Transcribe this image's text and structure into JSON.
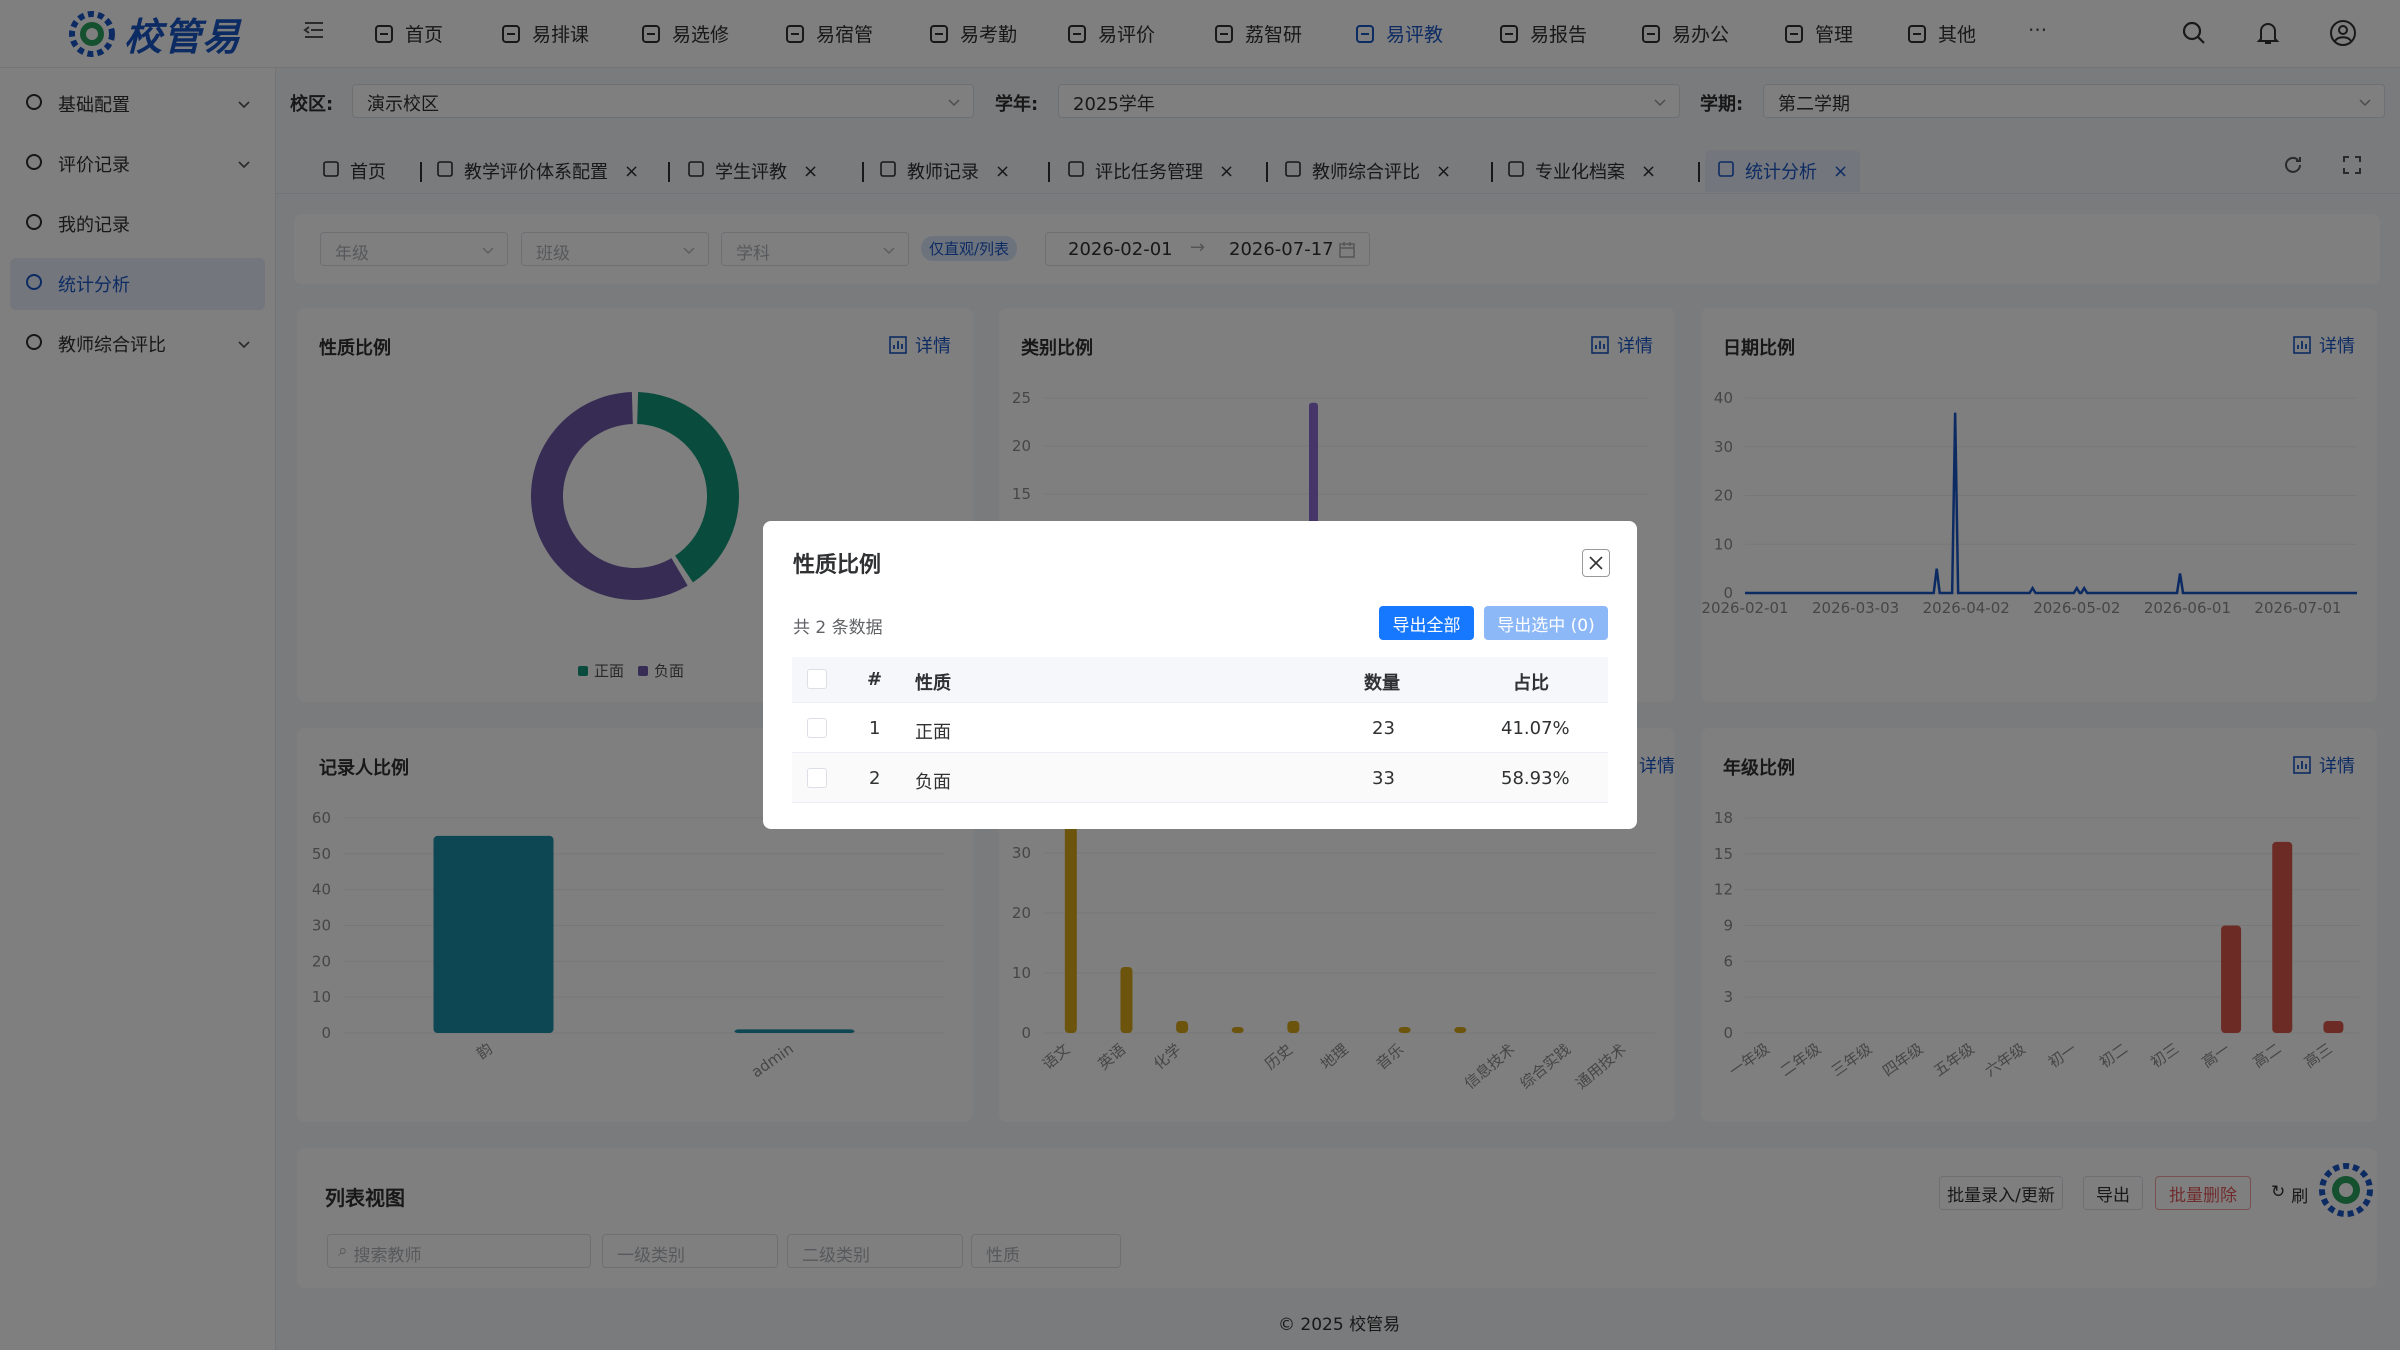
{
  "app": {
    "logo_text": "校管易"
  },
  "topnav": [
    {
      "label": "首页",
      "icon": "monitor-icon"
    },
    {
      "label": "易排课",
      "icon": "calendar-icon"
    },
    {
      "label": "易选修",
      "icon": "book-icon"
    },
    {
      "label": "易宿管",
      "icon": "bed-icon"
    },
    {
      "label": "易考勤",
      "icon": "calendar-check-icon"
    },
    {
      "label": "易评价",
      "icon": "star-icon"
    },
    {
      "label": "荔智研",
      "icon": "research-icon"
    },
    {
      "label": "易评教",
      "icon": "graduation-cap-icon"
    },
    {
      "label": "易报告",
      "icon": "report-icon"
    },
    {
      "label": "易办公",
      "icon": "briefcase-icon"
    },
    {
      "label": "管理",
      "icon": "settings-square-icon"
    },
    {
      "label": "其他",
      "icon": "grid-icon"
    }
  ],
  "topnav_more": "···",
  "sidebar": [
    {
      "label": "基础配置",
      "icon": "gear-icon",
      "expandable": true
    },
    {
      "label": "评价记录",
      "icon": "clipboard-icon",
      "expandable": true
    },
    {
      "label": "我的记录",
      "icon": "record-icon",
      "expandable": false
    },
    {
      "label": "统计分析",
      "icon": "chart-line-icon",
      "expandable": false,
      "active": true
    },
    {
      "label": "教师综合评比",
      "icon": "trophy-icon",
      "expandable": true
    }
  ],
  "filters": {
    "campus_label": "校区:",
    "campus_value": "演示校区",
    "year_label": "学年:",
    "year_value": "2025学年",
    "term_label": "学期:",
    "term_value": "第二学期"
  },
  "tabs": [
    {
      "label": "首页",
      "closable": false
    },
    {
      "label": "教学评价体系配置",
      "closable": true
    },
    {
      "label": "学生评教",
      "closable": true
    },
    {
      "label": "教师记录",
      "closable": true
    },
    {
      "label": "评比任务管理",
      "closable": true
    },
    {
      "label": "教师综合评比",
      "closable": true
    },
    {
      "label": "专业化档案",
      "closable": true
    },
    {
      "label": "统计分析",
      "closable": true,
      "active": true
    }
  ],
  "stats_filters": {
    "grade_placeholder": "年级",
    "class_placeholder": "班级",
    "subject_placeholder": "学科",
    "toggle_label": "仅直观/列表",
    "date_start": "2026-02-01",
    "date_end": "2026-07-17"
  },
  "detail_label": "详情",
  "charts": {
    "nature": {
      "title": "性质比例",
      "legend": [
        "正面",
        "负面"
      ]
    },
    "category": {
      "title": "类别比例"
    },
    "date": {
      "title": "日期比例"
    },
    "recorder": {
      "title": "记录人比例"
    },
    "grade": {
      "title": "年级比例"
    }
  },
  "chart_data": [
    {
      "type": "pie",
      "title": "性质比例",
      "categories": [
        "正面",
        "负面"
      ],
      "values": [
        23,
        33
      ],
      "colors": [
        "#129679",
        "#6f5aa8"
      ]
    },
    {
      "type": "bar",
      "title": "类别比例",
      "ylim": [
        0,
        25
      ],
      "yticks": [
        15,
        20,
        25
      ],
      "categories": [],
      "values": [],
      "colors": [
        "#8c6bd1"
      ]
    },
    {
      "type": "line",
      "title": "日期比例",
      "ylim": [
        0,
        40
      ],
      "yticks": [
        0,
        10,
        20,
        30,
        40
      ],
      "xticks": [
        "2026-02-01",
        "2026-03-03",
        "2026-04-02",
        "2026-05-02",
        "2026-06-01",
        "2026-07-01"
      ],
      "x": [
        "2026-02-01",
        "2026-03-25",
        "2026-03-30",
        "2026-04-20",
        "2026-05-02",
        "2026-05-04",
        "2026-05-30",
        "2026-07-17"
      ],
      "y": [
        0,
        5,
        37,
        1,
        1,
        1,
        4,
        0
      ],
      "colors": [
        "#1a56c7"
      ]
    },
    {
      "type": "bar",
      "title": "记录人比例",
      "ylim": [
        0,
        60
      ],
      "yticks": [
        0,
        10,
        20,
        30,
        40,
        50,
        60
      ],
      "categories": [
        "韵",
        "admin"
      ],
      "values": [
        55,
        1
      ],
      "colors": [
        "#1a8fa6"
      ]
    },
    {
      "type": "bar",
      "title": "",
      "ylim": [
        0,
        40
      ],
      "yticks": [
        0,
        10,
        20,
        30
      ],
      "categories": [
        "语文",
        "英语",
        "化学",
        "",
        "历史",
        "地理",
        "音乐",
        "",
        "信息技术",
        "综合实践",
        "通用技术"
      ],
      "values": [
        35,
        11,
        2,
        1,
        2,
        0,
        1,
        1,
        0,
        0,
        0
      ],
      "colors": [
        "#d8a81a"
      ]
    },
    {
      "type": "bar",
      "title": "年级比例",
      "ylim": [
        0,
        18
      ],
      "yticks": [
        0,
        3,
        6,
        9,
        12,
        15,
        18
      ],
      "categories": [
        "一年级",
        "二年级",
        "三年级",
        "四年级",
        "五年级",
        "六年级",
        "初一",
        "初二",
        "初三",
        "高一",
        "高二",
        "高三"
      ],
      "values": [
        0,
        0,
        0,
        0,
        0,
        0,
        0,
        0,
        0,
        9,
        16,
        1
      ],
      "colors": [
        "#d9584a"
      ]
    }
  ],
  "list_section": {
    "title": "列表视图",
    "batch_label": "批量录入/更新",
    "export_label": "导出",
    "delete_label": "批量删除",
    "refresh_label": "刷",
    "search_placeholder": "搜索教师",
    "cat1_placeholder": "一级类别",
    "cat2_placeholder": "二级类别",
    "nature_placeholder": "性质"
  },
  "footer": "© 2025 校管易",
  "dialog": {
    "title": "性质比例",
    "count_text": "共 2 条数据",
    "export_all": "导出全部",
    "export_selected": "导出选中 (0)",
    "columns": [
      "#",
      "性质",
      "数量",
      "占比"
    ],
    "rows": [
      {
        "index": "1",
        "nature": "正面",
        "count": "23",
        "percent": "41.07%"
      },
      {
        "index": "2",
        "nature": "负面",
        "count": "33",
        "percent": "58.93%"
      }
    ]
  }
}
